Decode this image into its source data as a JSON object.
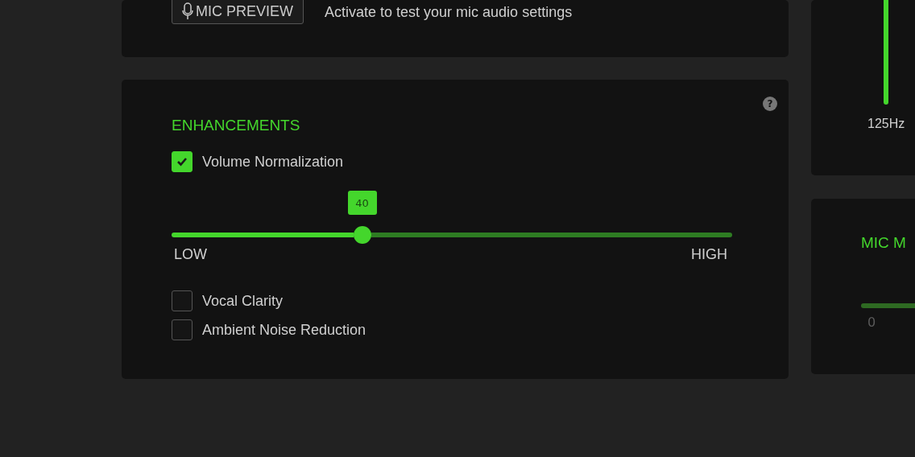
{
  "mic_preview": {
    "button": "MIC PREVIEW",
    "description": "Activate to test your mic audio settings"
  },
  "enhancements": {
    "title": "ENHANCEMENTS",
    "help": "?",
    "volume_normalization": {
      "label": "Volume Normalization",
      "checked": true,
      "slider": {
        "value": "40",
        "level": 0.34,
        "min_label": "LOW",
        "max_label": "HIGH"
      }
    },
    "options": [
      {
        "label": "Vocal Clarity",
        "checked": false
      },
      {
        "label": "Ambient Noise Reduction",
        "checked": false
      }
    ]
  },
  "equalizer": {
    "band_label": "125Hz"
  },
  "mic_monitoring": {
    "title": "MIC M",
    "slider_min": "0"
  }
}
